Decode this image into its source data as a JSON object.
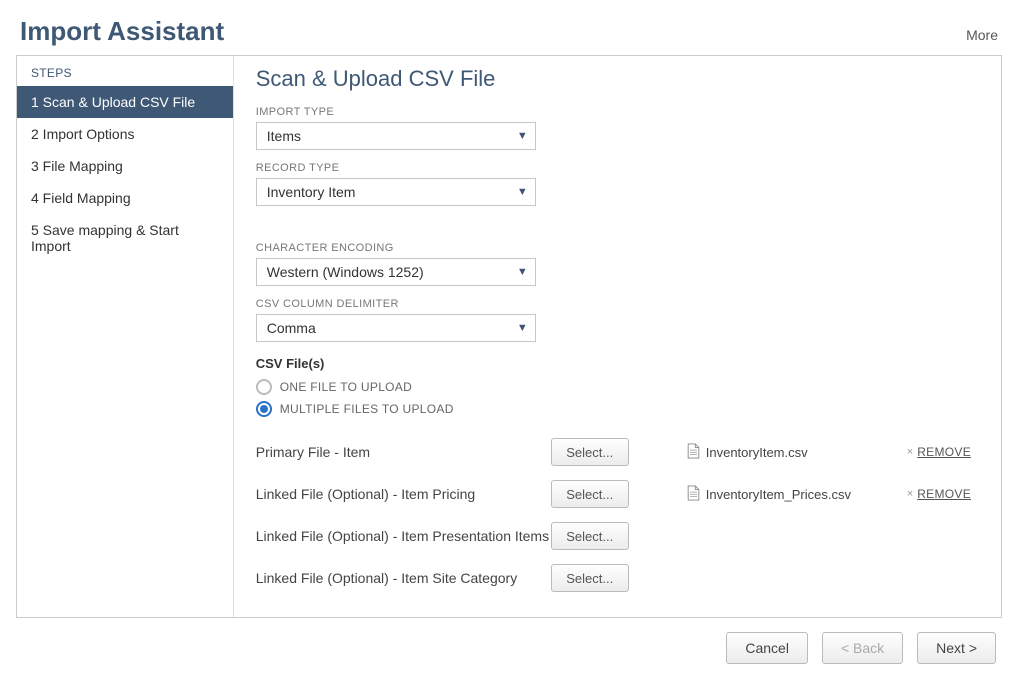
{
  "header": {
    "title": "Import Assistant",
    "more": "More"
  },
  "sidebar": {
    "heading": "STEPS",
    "items": [
      {
        "label": "1 Scan & Upload CSV File",
        "active": true
      },
      {
        "label": "2 Import Options",
        "active": false
      },
      {
        "label": "3 File Mapping",
        "active": false
      },
      {
        "label": "4 Field Mapping",
        "active": false
      },
      {
        "label": "5 Save mapping & Start Import",
        "active": false
      }
    ]
  },
  "main": {
    "title": "Scan & Upload CSV File",
    "fields": {
      "import_type": {
        "label": "IMPORT TYPE",
        "value": "Items"
      },
      "record_type": {
        "label": "RECORD TYPE",
        "value": "Inventory Item"
      },
      "encoding": {
        "label": "CHARACTER ENCODING",
        "value": "Western (Windows 1252)"
      },
      "delimiter": {
        "label": "CSV COLUMN DELIMITER",
        "value": "Comma"
      }
    },
    "csv": {
      "heading": "CSV File(s)",
      "radio_one": "ONE FILE TO UPLOAD",
      "radio_multi": "MULTIPLE FILES TO UPLOAD",
      "selected": "multi",
      "select_btn": "Select...",
      "remove_label": "REMOVE",
      "rows": [
        {
          "label": "Primary File - Item",
          "filename": "InventoryItem.csv"
        },
        {
          "label": "Linked File (Optional) - Item Pricing",
          "filename": "InventoryItem_Prices.csv"
        },
        {
          "label": "Linked File (Optional) - Item Presentation Items",
          "filename": ""
        },
        {
          "label": "Linked File (Optional) - Item Site Category",
          "filename": ""
        }
      ]
    }
  },
  "footer": {
    "cancel": "Cancel",
    "back": "< Back",
    "next": "Next >"
  }
}
